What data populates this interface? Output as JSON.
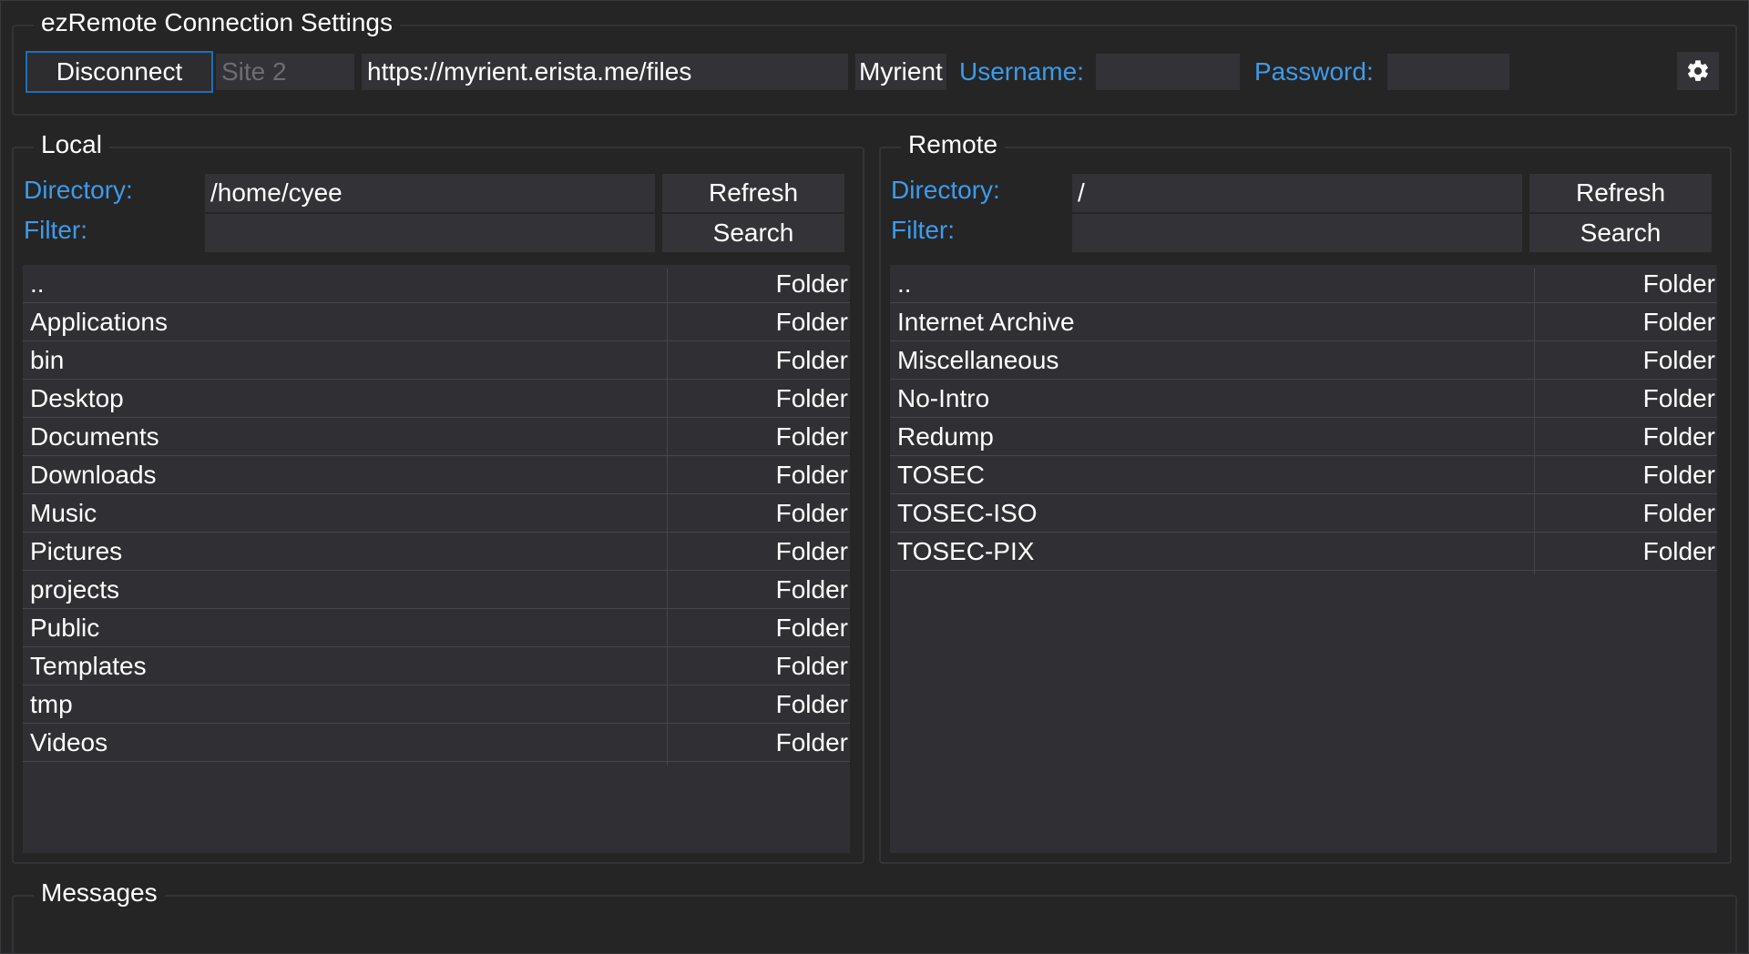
{
  "connection": {
    "title": "ezRemote Connection Settings",
    "disconnect_label": "Disconnect",
    "site_value": "Site 2",
    "url_value": "https://myrient.erista.me/files",
    "server_name": "Myrient",
    "username_label": "Username:",
    "username_value": "",
    "password_label": "Password:",
    "password_value": "",
    "settings_icon": "gear-icon"
  },
  "local": {
    "title": "Local",
    "directory_label": "Directory:",
    "directory_value": "/home/cyee",
    "filter_label": "Filter:",
    "filter_value": "",
    "refresh_label": "Refresh",
    "search_label": "Search",
    "files": [
      {
        "name": "..",
        "type": "Folder"
      },
      {
        "name": "Applications",
        "type": "Folder"
      },
      {
        "name": "bin",
        "type": "Folder"
      },
      {
        "name": "Desktop",
        "type": "Folder"
      },
      {
        "name": "Documents",
        "type": "Folder"
      },
      {
        "name": "Downloads",
        "type": "Folder"
      },
      {
        "name": "Music",
        "type": "Folder"
      },
      {
        "name": "Pictures",
        "type": "Folder"
      },
      {
        "name": "projects",
        "type": "Folder"
      },
      {
        "name": "Public",
        "type": "Folder"
      },
      {
        "name": "Templates",
        "type": "Folder"
      },
      {
        "name": "tmp",
        "type": "Folder"
      },
      {
        "name": "Videos",
        "type": "Folder"
      }
    ]
  },
  "remote": {
    "title": "Remote",
    "directory_label": "Directory:",
    "directory_value": "/",
    "filter_label": "Filter:",
    "filter_value": "",
    "refresh_label": "Refresh",
    "search_label": "Search",
    "files": [
      {
        "name": "..",
        "type": "Folder"
      },
      {
        "name": "Internet Archive",
        "type": "Folder"
      },
      {
        "name": "Miscellaneous",
        "type": "Folder"
      },
      {
        "name": "No-Intro",
        "type": "Folder"
      },
      {
        "name": "Redump",
        "type": "Folder"
      },
      {
        "name": "TOSEC",
        "type": "Folder"
      },
      {
        "name": "TOSEC-ISO",
        "type": "Folder"
      },
      {
        "name": "TOSEC-PIX",
        "type": "Folder"
      }
    ]
  },
  "messages": {
    "title": "Messages"
  },
  "colors": {
    "background": "#252526",
    "accent_label": "#3d9be9",
    "field_bg": "#333337",
    "active_border": "#1f6fb5"
  }
}
